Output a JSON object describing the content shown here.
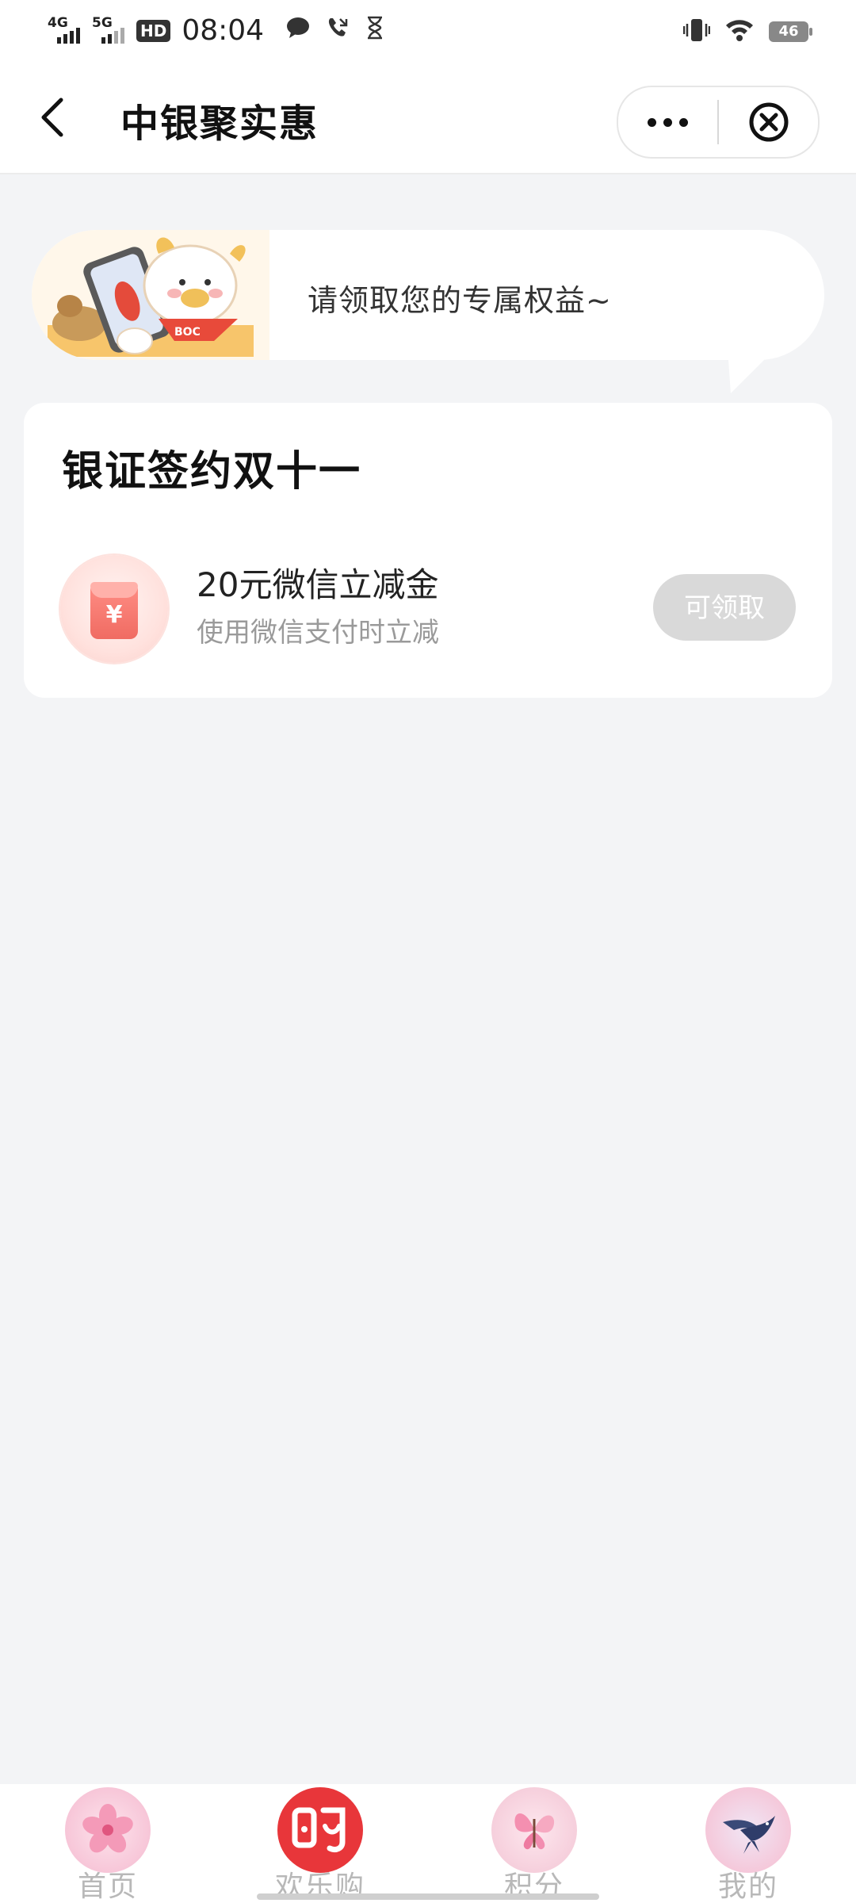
{
  "status_bar": {
    "net1": "4G",
    "net2": "5G",
    "hd": "HD",
    "time": "08:04",
    "battery": "46",
    "icons": [
      "wechat-bubble-icon",
      "missed-call-icon",
      "hourglass-icon",
      "vibrate-icon",
      "wifi-icon",
      "battery-icon"
    ]
  },
  "navbar": {
    "title": "中银聚实惠"
  },
  "banner": {
    "text": "请领取您的专属权益~",
    "mascot_label": "BOC"
  },
  "card": {
    "title": "银证签约双十一",
    "coupon": {
      "name": "20元微信立减金",
      "desc": "使用微信支付时立减",
      "icon_glyph": "¥",
      "button": "可领取"
    }
  },
  "tabbar": {
    "items": [
      {
        "label": "首页",
        "icon": "cherry-blossom-icon"
      },
      {
        "label": "欢乐购",
        "icon": "shopping-logo-icon"
      },
      {
        "label": "积分",
        "icon": "butterfly-icon"
      },
      {
        "label": "我的",
        "icon": "swallow-icon"
      }
    ]
  },
  "colors": {
    "background": "#f3f4f6",
    "button_disabled": "#d9d9d9",
    "accent_red": "#e8363a"
  }
}
